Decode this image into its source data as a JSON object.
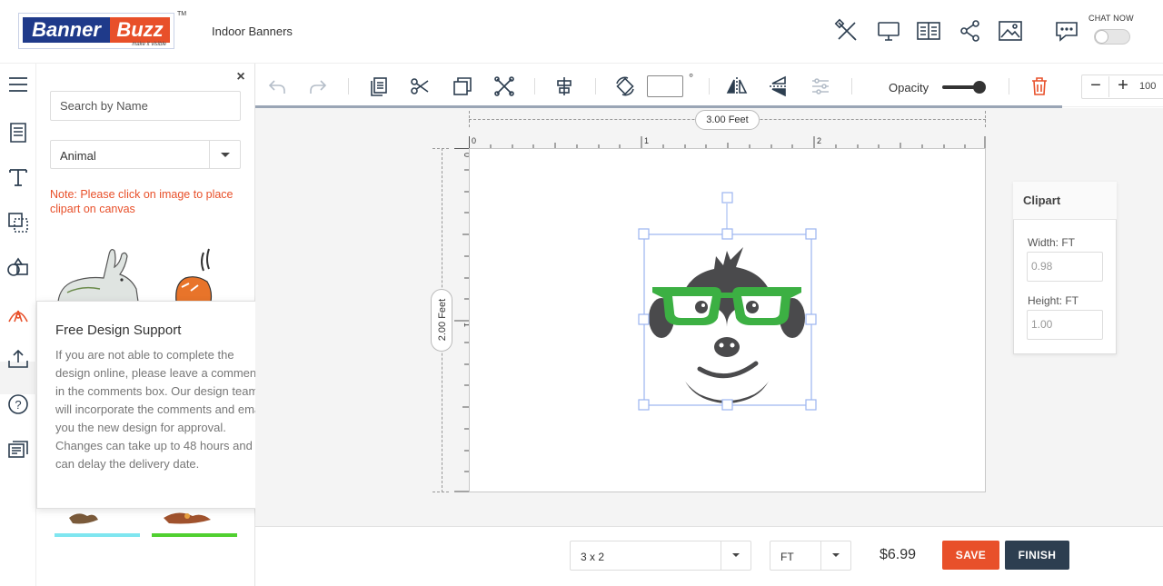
{
  "brand": {
    "logo_left": "Banner",
    "logo_right": "Buzz",
    "tagline": "make it visible",
    "trademark": "TM",
    "brand_blue": "#1f3a8a",
    "brand_orange": "#e8502a"
  },
  "header": {
    "product_name": "Indoor Banners",
    "icons": [
      "design-tools-icon",
      "desktop-preview-icon",
      "templates-icon",
      "share-icon",
      "image-icon",
      "chat-icon"
    ],
    "chat_label": "CHAT NOW",
    "chat_enabled": false
  },
  "rail": {
    "icons": [
      "menu-icon",
      "templates-icon",
      "text-icon",
      "background-icon",
      "shapes-icon",
      "clipart-icon",
      "upload-icon",
      "help-icon",
      "comments-icon"
    ],
    "active": "clipart-icon",
    "accent": "#e8502a"
  },
  "panel": {
    "search_placeholder": "Search by Name",
    "category": "Animal",
    "note": "Note: Please click on image to place clipart on canvas",
    "close_glyph": "×"
  },
  "popup": {
    "title": "Free Design Support",
    "body": "If you are not able to complete the design online, please leave a comments in the comments box. Our design team will incorporate the comments and email you the new design for approval. Changes can take up to 48 hours and can delay the delivery date.",
    "close_glyph": "×"
  },
  "toolbar": {
    "rotation_value": "",
    "degree_symbol": "°",
    "opacity_label": "Opacity",
    "opacity_value": 1.0,
    "zoom_minus": "−",
    "zoom_plus": "+",
    "zoom_value": "100"
  },
  "canvas": {
    "width_label": "3.00 Feet",
    "height_label": "2.00 Feet",
    "ruler_top_labels": [
      "0",
      "1",
      "2"
    ],
    "ruler_left_labels": [
      "0",
      "1"
    ]
  },
  "clipart_props": {
    "title": "Clipart",
    "width_label": "Width: FT",
    "width_value": "0.98",
    "height_label": "Height: FT",
    "height_value": "1.00"
  },
  "footer": {
    "size_value": "3 x 2",
    "unit_value": "FT",
    "price": "$6.99",
    "save_label": "SAVE",
    "finish_label": "FINISH"
  }
}
